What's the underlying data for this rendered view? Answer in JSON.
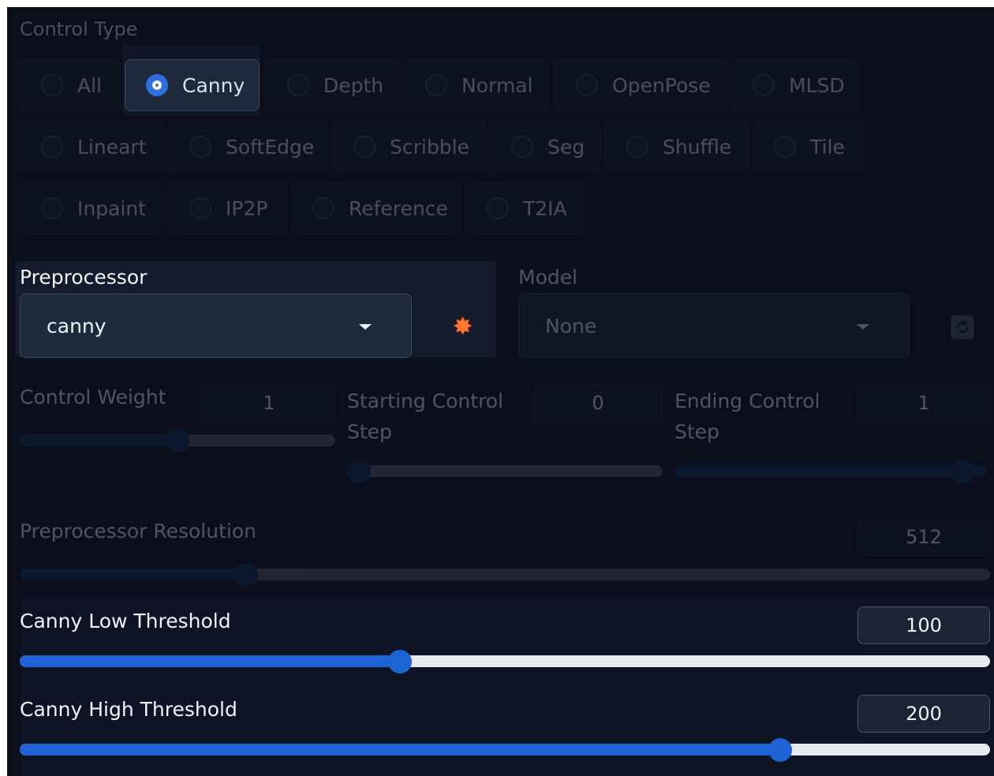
{
  "control_type": {
    "label": "Control Type",
    "selected": "Canny",
    "options": [
      "All",
      "Canny",
      "Depth",
      "Normal",
      "OpenPose",
      "MLSD",
      "Lineart",
      "SoftEdge",
      "Scribble",
      "Seg",
      "Shuffle",
      "Tile",
      "Inpaint",
      "IP2P",
      "Reference",
      "T2IA"
    ]
  },
  "preprocessor": {
    "label": "Preprocessor",
    "value": "canny",
    "run_icon": "explosion-icon"
  },
  "model": {
    "label": "Model",
    "value": "None",
    "refresh_icon": "refresh-icon"
  },
  "sliders": {
    "control_weight": {
      "label": "Control Weight",
      "value": "1",
      "fraction": 0.5
    },
    "starting_step": {
      "label": "Starting Control Step",
      "value": "0",
      "fraction": 0.0
    },
    "ending_step": {
      "label": "Ending Control Step",
      "value": "1",
      "fraction": 1.0
    },
    "resolution": {
      "label": "Preprocessor Resolution",
      "value": "512",
      "fraction": 0.233
    },
    "canny_low": {
      "label": "Canny Low Threshold",
      "value": "100",
      "fraction": 0.392
    },
    "canny_high": {
      "label": "Canny High Threshold",
      "value": "200",
      "fraction": 0.784
    }
  },
  "colors": {
    "accent": "#1e63d6",
    "background": "#0a0f1b",
    "panel": "#131b2c"
  }
}
